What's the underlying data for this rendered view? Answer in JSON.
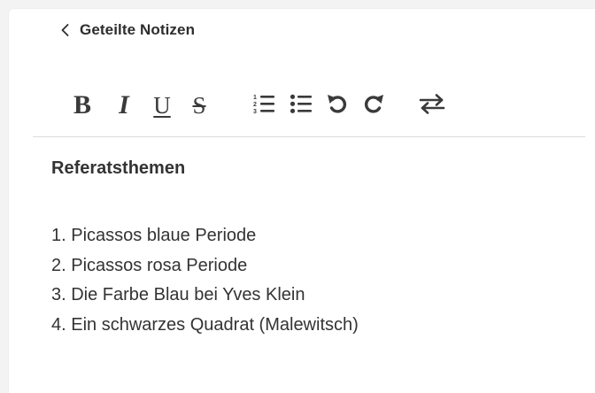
{
  "nav": {
    "back_label": "Geteilte Notizen",
    "back_icon": "chevron-left-icon"
  },
  "toolbar": {
    "bold_label": "B",
    "italic_label": "I",
    "underline_label": "U",
    "strike_label": "S",
    "buttons": [
      {
        "name": "bold",
        "icon": "bold-icon"
      },
      {
        "name": "italic",
        "icon": "italic-icon"
      },
      {
        "name": "underline",
        "icon": "underline-icon"
      },
      {
        "name": "strikethrough",
        "icon": "strikethrough-icon"
      },
      {
        "name": "ordered-list",
        "icon": "ordered-list-icon"
      },
      {
        "name": "bullet-list",
        "icon": "bullet-list-icon"
      },
      {
        "name": "undo",
        "icon": "undo-icon"
      },
      {
        "name": "redo",
        "icon": "redo-icon"
      },
      {
        "name": "swap",
        "icon": "swap-arrows-icon"
      }
    ]
  },
  "note": {
    "title": "Referatsthemen",
    "items": [
      "1. Picassos blaue Periode",
      "2. Picassos rosa Periode",
      "3. Die Farbe Blau bei Yves Klein",
      "4. Ein schwarzes Quadrat (Malewitsch)"
    ]
  },
  "colors": {
    "background": "#f3f3f3",
    "panel": "#ffffff",
    "text": "#333333",
    "icon": "#3a3a3a",
    "divider": "#dcdcdc"
  }
}
